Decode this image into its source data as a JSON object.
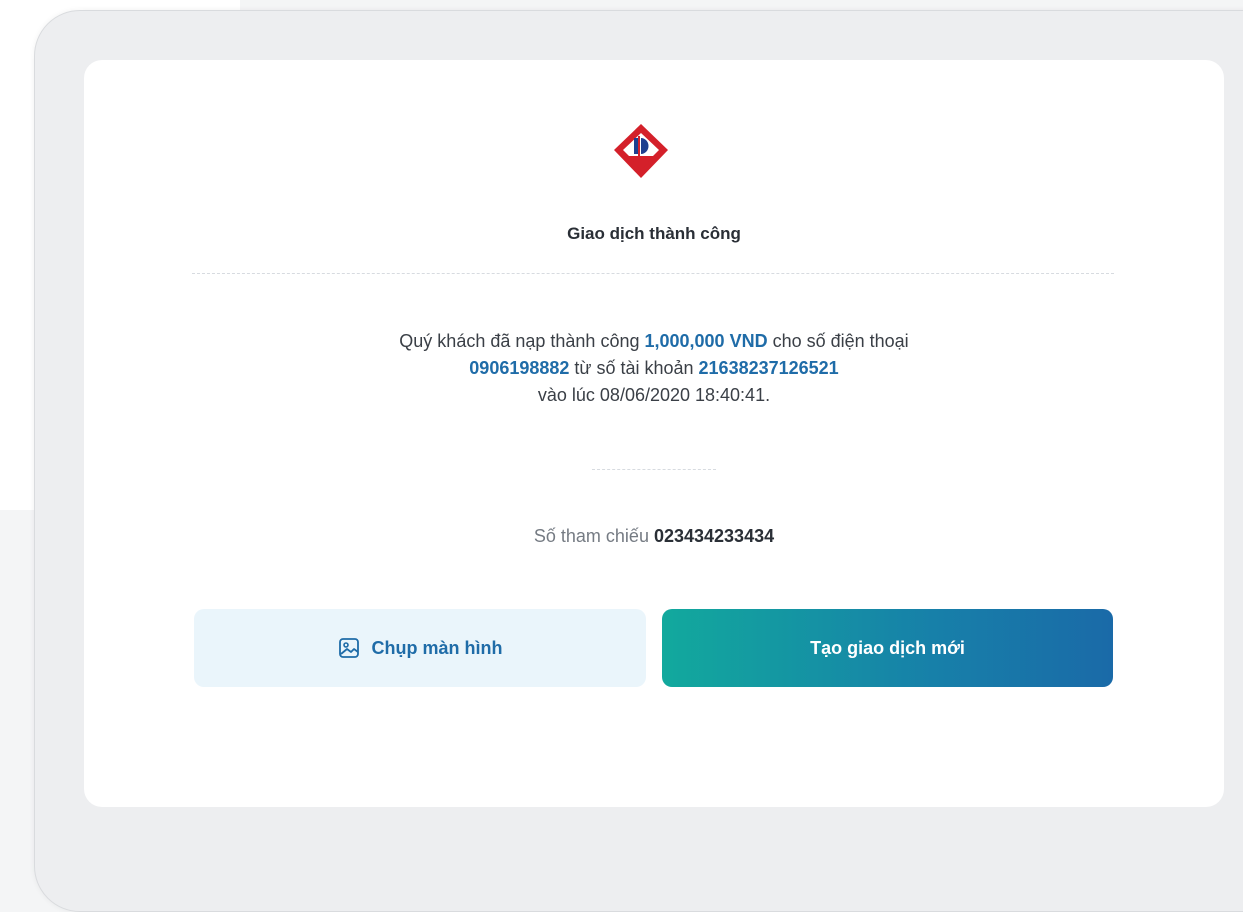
{
  "receipt": {
    "title": "Giao dịch thành công",
    "message": {
      "part1": "Quý khách đã nạp thành công ",
      "amount": "1,000,000 VND",
      "part2": " cho số điện thoại",
      "phone": "0906198882",
      "part3": " từ số tài khoản ",
      "account": "21638237126521",
      "part4": "vào lúc 08/06/2020 18:40:41."
    },
    "reference_label": "Số tham chiếu ",
    "reference_number": "023434233434"
  },
  "actions": {
    "screenshot_label": "Chụp màn hình",
    "new_transaction_label": "Tạo giao dịch mới"
  },
  "icons": {
    "logo": "bank-logo-icon",
    "screenshot": "image-icon"
  },
  "colors": {
    "highlight": "#1f6ca8",
    "logo_red": "#d4202a",
    "button_gradient_start": "#12a99d",
    "button_gradient_end": "#1a6aa8"
  }
}
